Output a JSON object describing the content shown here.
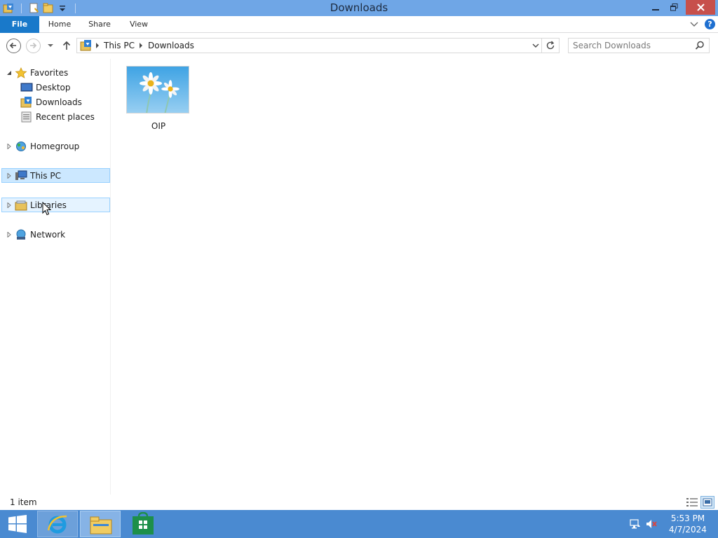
{
  "window": {
    "title": "Downloads"
  },
  "ribbon": {
    "tabs": [
      "File",
      "Home",
      "Share",
      "View"
    ],
    "help_label": "?"
  },
  "address": {
    "crumbs": [
      "This PC",
      "Downloads"
    ],
    "search_placeholder": "Search Downloads"
  },
  "navpane": {
    "favorites": {
      "label": "Favorites",
      "items": [
        "Desktop",
        "Downloads",
        "Recent places"
      ]
    },
    "homegroup": "Homegroup",
    "this_pc": "This PC",
    "libraries": "Libraries",
    "network": "Network"
  },
  "content": {
    "files": [
      {
        "name": "OIP",
        "type": "image"
      }
    ]
  },
  "status": {
    "item_count": "1 item"
  },
  "taskbar": {
    "time": "5:53 PM",
    "date": "4/7/2024"
  },
  "colors": {
    "titlebar": "#6fa6e6",
    "file_tab": "#1979ca",
    "close": "#c7504b",
    "taskbar": "#4a8ad1",
    "selection": "#cce8ff"
  }
}
